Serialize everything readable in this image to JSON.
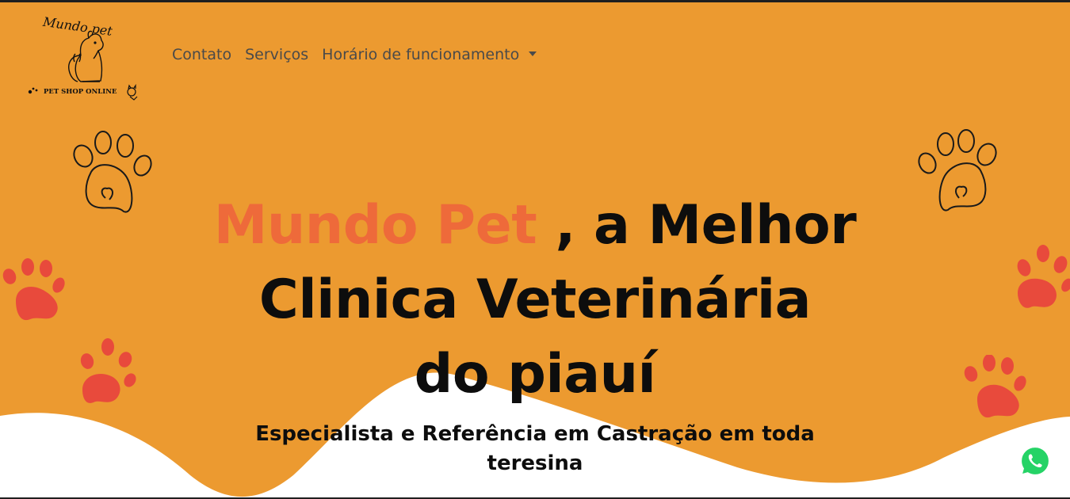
{
  "colors": {
    "background_orange": "#ec9a30",
    "wave_white": "#ffffff",
    "brand_text": "#ee6a3a",
    "heading_text": "#0d0d0d",
    "nav_text": "#4a4a4a",
    "paw_red": "#e84a3c",
    "paw_outline": "#1a1a1a",
    "whatsapp_green": "#25d366"
  },
  "logo": {
    "title": "Mundo pet",
    "tagline": "PET SHOP ONLINE",
    "icon": "sitting-dog-cat-icon"
  },
  "nav": {
    "items": [
      {
        "label": "Contato"
      },
      {
        "label": "Serviços"
      },
      {
        "label": "Horário de funcionamento",
        "icon": "caret-down-icon"
      }
    ]
  },
  "hero": {
    "brand": "Mundo Pet",
    "title_rest": ", a Melhor",
    "title_line2": "Clinica Veterinária",
    "title_line3": "do piauí",
    "subtitle_line1": "Especialista e Referência em Castração em toda",
    "subtitle_line2": "teresina"
  },
  "floating": {
    "whatsapp_icon": "whatsapp-icon"
  }
}
